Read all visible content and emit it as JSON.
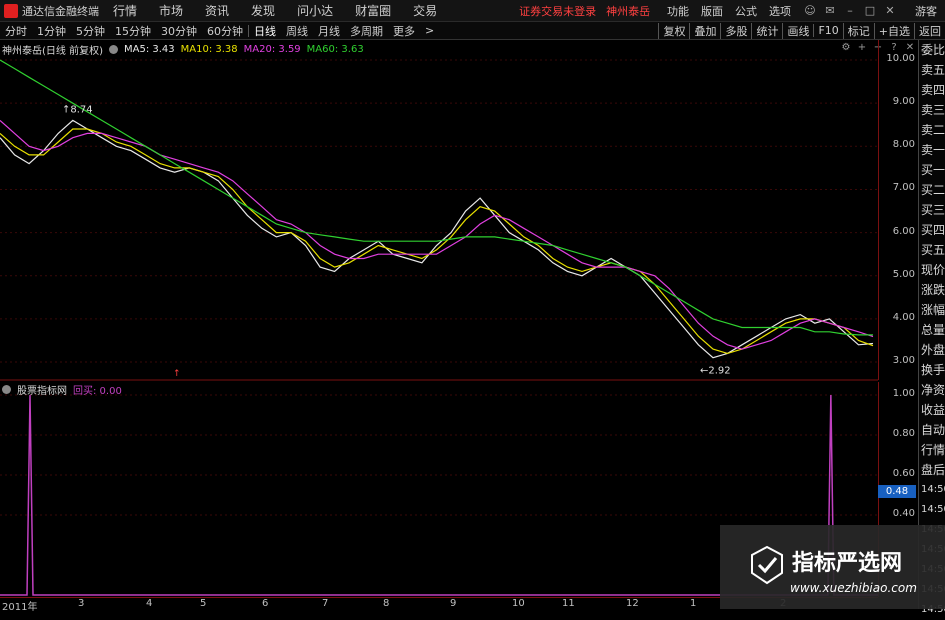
{
  "menubar": {
    "app_title": "通达信金融终端",
    "items": [
      "行情",
      "市场",
      "资讯",
      "发现",
      "问小达",
      "财富圈",
      "交易"
    ],
    "notice": "证券交易未登录",
    "stock_title": "神州泰岳",
    "tools": [
      "功能",
      "版面",
      "公式",
      "选项"
    ],
    "guest": "游客"
  },
  "tabbar": {
    "tabs": [
      "分时",
      "1分钟",
      "5分钟",
      "15分钟",
      "30分钟",
      "60分钟",
      "日线",
      "周线",
      "月线",
      "多周期",
      "更多"
    ],
    "active": "日线",
    "right_buttons": [
      "复权",
      "叠加",
      "多股",
      "统计",
      "画线",
      "F10",
      "标记",
      "+自选",
      "返回"
    ]
  },
  "legend": {
    "title": "神州泰岳(日线 前复权)",
    "ma5": "MA5: 3.43",
    "ma10": "MA10: 3.38",
    "ma20": "MA20: 3.59",
    "ma60": "MA60: 3.63",
    "colors": {
      "ma5": "#e8e8e8",
      "ma10": "#e8e000",
      "ma20": "#e040e0",
      "ma60": "#30d030"
    }
  },
  "indicator": {
    "name": "股票指标网",
    "line_label": "回买: 0.00",
    "current_value": "0.48",
    "color": "#c040c0"
  },
  "chart_data": {
    "type": "line",
    "price_axis": {
      "ticks": [
        "10.00",
        "9.00",
        "8.00",
        "7.00",
        "6.00",
        "5.00",
        "4.00",
        "3.00"
      ],
      "ylim": [
        2.7,
        10.0
      ]
    },
    "indicator_axis": {
      "ticks": [
        "1.00",
        "0.80",
        "0.60",
        "0.40"
      ],
      "ylim": [
        0,
        1.0
      ]
    },
    "annotations": [
      {
        "text": "8.74",
        "value": 8.74
      },
      {
        "text": "2.92",
        "value": 2.92
      }
    ],
    "date_labels": [
      "2011年",
      "3",
      "4",
      "5",
      "6",
      "7",
      "8",
      "9",
      "10",
      "11",
      "12",
      "1",
      "2"
    ],
    "series": [
      {
        "color": "#e8e8e8",
        "values": [
          8.2,
          7.8,
          7.6,
          7.9,
          8.3,
          8.6,
          8.4,
          8.2,
          8.0,
          7.9,
          7.7,
          7.5,
          7.4,
          7.5,
          7.4,
          7.2,
          6.8,
          6.4,
          6.1,
          5.9,
          6.0,
          5.7,
          5.2,
          5.1,
          5.4,
          5.6,
          5.8,
          5.5,
          5.4,
          5.3,
          5.7,
          6.0,
          6.5,
          6.8,
          6.4,
          6.0,
          5.8,
          5.6,
          5.3,
          5.1,
          5.0,
          5.2,
          5.4,
          5.2,
          5.0,
          4.6,
          4.2,
          3.8,
          3.4,
          3.1,
          3.2,
          3.4,
          3.6,
          3.8,
          4.0,
          4.1,
          3.9,
          4.0,
          3.7,
          3.4,
          3.43
        ]
      },
      {
        "color": "#e8e000",
        "values": [
          8.3,
          8.0,
          7.8,
          7.8,
          8.1,
          8.4,
          8.4,
          8.3,
          8.1,
          8.0,
          7.8,
          7.6,
          7.5,
          7.5,
          7.4,
          7.3,
          7.0,
          6.6,
          6.3,
          6.0,
          6.0,
          5.8,
          5.4,
          5.2,
          5.3,
          5.5,
          5.7,
          5.6,
          5.5,
          5.4,
          5.6,
          5.9,
          6.3,
          6.6,
          6.5,
          6.2,
          5.9,
          5.7,
          5.4,
          5.2,
          5.1,
          5.2,
          5.3,
          5.2,
          5.1,
          4.8,
          4.4,
          4.0,
          3.6,
          3.3,
          3.2,
          3.3,
          3.5,
          3.7,
          3.9,
          4.0,
          4.0,
          3.9,
          3.8,
          3.5,
          3.38
        ]
      },
      {
        "color": "#e040e0",
        "values": [
          8.6,
          8.3,
          8.0,
          7.9,
          8.0,
          8.2,
          8.3,
          8.3,
          8.2,
          8.1,
          8.0,
          7.8,
          7.7,
          7.6,
          7.5,
          7.4,
          7.2,
          6.9,
          6.6,
          6.3,
          6.2,
          6.0,
          5.7,
          5.5,
          5.4,
          5.4,
          5.5,
          5.5,
          5.5,
          5.5,
          5.5,
          5.7,
          5.9,
          6.2,
          6.4,
          6.3,
          6.1,
          5.9,
          5.7,
          5.5,
          5.3,
          5.2,
          5.2,
          5.2,
          5.1,
          5.0,
          4.7,
          4.3,
          3.9,
          3.6,
          3.4,
          3.3,
          3.4,
          3.5,
          3.7,
          3.9,
          4.0,
          3.9,
          3.8,
          3.7,
          3.59
        ]
      },
      {
        "color": "#30d030",
        "values": [
          10.0,
          9.8,
          9.6,
          9.4,
          9.2,
          9.0,
          8.8,
          8.6,
          8.4,
          8.2,
          8.0,
          7.8,
          7.6,
          7.4,
          7.2,
          7.0,
          6.8,
          6.6,
          6.4,
          6.2,
          6.1,
          6.0,
          5.95,
          5.9,
          5.85,
          5.8,
          5.8,
          5.8,
          5.8,
          5.8,
          5.8,
          5.85,
          5.9,
          5.9,
          5.9,
          5.85,
          5.8,
          5.75,
          5.7,
          5.6,
          5.5,
          5.4,
          5.3,
          5.2,
          5.0,
          4.8,
          4.6,
          4.4,
          4.2,
          4.0,
          3.9,
          3.8,
          3.8,
          3.8,
          3.8,
          3.8,
          3.7,
          3.7,
          3.65,
          3.63,
          3.63
        ]
      }
    ],
    "indicator_spikes": [
      {
        "index": 0,
        "value": 1.0
      },
      {
        "index": 57,
        "value": 1.0
      }
    ]
  },
  "sidepanel": {
    "items": [
      "委比",
      "卖五",
      "卖四",
      "卖三",
      "卖二",
      "卖一",
      "买一",
      "买二",
      "买三",
      "买四",
      "买五",
      "现价",
      "涨跌",
      "涨幅",
      "总量",
      "外盘",
      "换手",
      "净资",
      "收益",
      "自动",
      "行情",
      "盘后"
    ],
    "times": [
      "14:50",
      "14:50",
      "14:50",
      "14:50",
      "14:50",
      "14:50",
      "14:50"
    ]
  },
  "watermark": {
    "title": "指标严选网",
    "url": "www.xuezhibiao.com"
  }
}
